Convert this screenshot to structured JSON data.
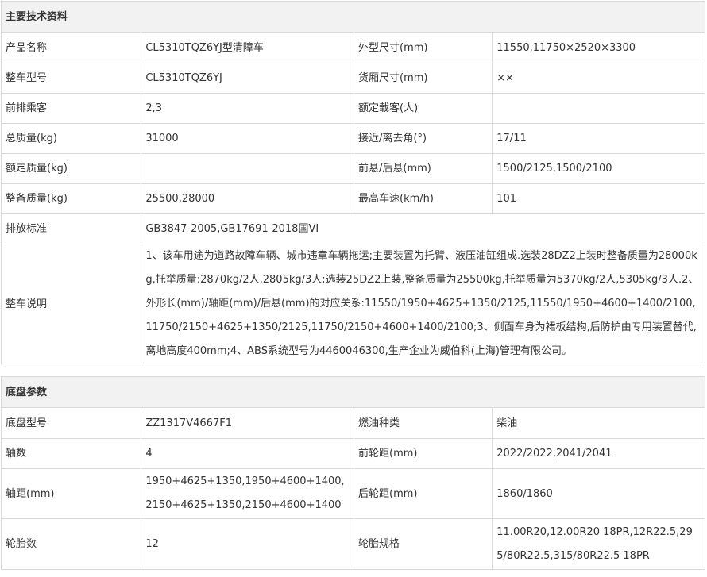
{
  "spec": {
    "title": "主要技术资料",
    "rows": [
      [
        "产品名称",
        "CL5310TQZ6YJ型清障车",
        "外型尺寸(mm)",
        "11550,11750×2520×3300"
      ],
      [
        "整车型号",
        "CL5310TQZ6YJ",
        "货厢尺寸(mm)",
        "××"
      ],
      [
        "前排乘客",
        "2,3",
        "额定载客(人)",
        ""
      ],
      [
        "总质量(kg)",
        "31000",
        "接近/离去角(°)",
        "17/11"
      ],
      [
        "额定质量(kg)",
        "",
        "前悬/后悬(mm)",
        "1500/2125,1500/2100"
      ],
      [
        "整备质量(kg)",
        "25500,28000",
        "最高车速(km/h)",
        "101"
      ]
    ],
    "emission_label": "排放标准",
    "emission_value": "GB3847-2005,GB17691-2018国VI",
    "desc_label": "整车说明",
    "desc_value": "1、该车用途为道路故障车辆、城市违章车辆拖运;主要装置为托臂、液压油缸组成.选装28DZ2上装时整备质量为28000kg,托举质量:2870kg/2人,2805kg/3人;选装25DZ2上装,整备质量为25500kg,托举质量为5370kg/2人,5305kg/3人.2、外形长(mm)/轴距(mm)/后悬(mm)的对应关系:11550/1950+4625+1350/2125,11550/1950+4600+1400/2100,11750/2150+4625+1350/2125,11750/2150+4600+1400/2100;3、侧面车身为裙板结构,后防护由专用装置替代,离地高度400mm;4、ABS系统型号为4460046300,生产企业为威伯科(上海)管理有限公司。"
  },
  "chassis": {
    "title": "底盘参数",
    "rows": [
      [
        "底盘型号",
        "ZZ1317V4667F1",
        "燃油种类",
        "柴油"
      ],
      [
        "轴数",
        "4",
        "前轮距(mm)",
        "2022/2022,2041/2041"
      ],
      [
        "轴距(mm)",
        "1950+4625+1350,1950+4600+1400,2150+4625+1350,2150+4600+1400",
        "后轮距(mm)",
        "1860/1860"
      ],
      [
        "轮胎数",
        "12",
        "轮胎规格",
        "11.00R20,12.00R20 18PR,12R22.5,295/80R22.5,315/80R22.5 18PR"
      ]
    ]
  }
}
